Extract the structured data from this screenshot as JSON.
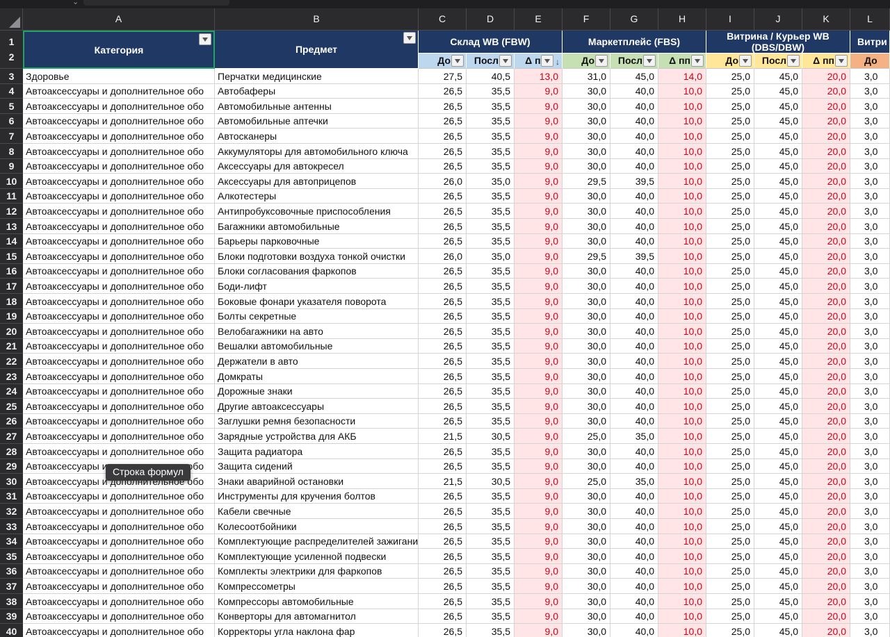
{
  "columns": [
    "A",
    "B",
    "C",
    "D",
    "E",
    "F",
    "G",
    "H",
    "I",
    "J",
    "K",
    "L"
  ],
  "row_numbers_header": [
    "1",
    "2"
  ],
  "headers": {
    "category": "Категория",
    "subject": "Предмет",
    "groups": [
      {
        "title": "Склад WB (FBW)",
        "color": "#bdd7ee"
      },
      {
        "title": "Маркетплейс (FBS)",
        "color": "#c6e0b4"
      },
      {
        "title": "Витрина / Курьер WB (DBS/DBW)",
        "color": "#ffe699"
      },
      {
        "title": "Витри",
        "color": "#f8cbad"
      }
    ],
    "subcols": [
      "До",
      "Посл",
      "Δ пп",
      "До",
      "Посл",
      "Δ пп",
      "До",
      "Посл",
      "Δ пп",
      "До"
    ]
  },
  "rows": [
    {
      "n": "3",
      "cat": "Здоровье",
      "subj": "Перчатки медицинские",
      "v": [
        "27,5",
        "40,5",
        "13,0",
        "31,0",
        "45,0",
        "14,0",
        "25,0",
        "45,0",
        "20,0",
        "3,0"
      ]
    },
    {
      "n": "4",
      "cat": "Автоаксессуары и дополнительное обо",
      "subj": "Автобаферы",
      "v": [
        "26,5",
        "35,5",
        "9,0",
        "30,0",
        "40,0",
        "10,0",
        "25,0",
        "45,0",
        "20,0",
        "3,0"
      ]
    },
    {
      "n": "5",
      "cat": "Автоаксессуары и дополнительное обо",
      "subj": "Автомобильные антенны",
      "v": [
        "26,5",
        "35,5",
        "9,0",
        "30,0",
        "40,0",
        "10,0",
        "25,0",
        "45,0",
        "20,0",
        "3,0"
      ]
    },
    {
      "n": "6",
      "cat": "Автоаксессуары и дополнительное обо",
      "subj": "Автомобильные аптечки",
      "v": [
        "26,5",
        "35,5",
        "9,0",
        "30,0",
        "40,0",
        "10,0",
        "25,0",
        "45,0",
        "20,0",
        "3,0"
      ]
    },
    {
      "n": "7",
      "cat": "Автоаксессуары и дополнительное обо",
      "subj": "Автосканеры",
      "v": [
        "26,5",
        "35,5",
        "9,0",
        "30,0",
        "40,0",
        "10,0",
        "25,0",
        "45,0",
        "20,0",
        "3,0"
      ]
    },
    {
      "n": "8",
      "cat": "Автоаксессуары и дополнительное обо",
      "subj": "Аккумуляторы для автомобильного ключа",
      "v": [
        "26,5",
        "35,5",
        "9,0",
        "30,0",
        "40,0",
        "10,0",
        "25,0",
        "45,0",
        "20,0",
        "3,0"
      ]
    },
    {
      "n": "9",
      "cat": "Автоаксессуары и дополнительное обо",
      "subj": "Аксессуары для автокресел",
      "v": [
        "26,5",
        "35,5",
        "9,0",
        "30,0",
        "40,0",
        "10,0",
        "25,0",
        "45,0",
        "20,0",
        "3,0"
      ]
    },
    {
      "n": "10",
      "cat": "Автоаксессуары и дополнительное обо",
      "subj": "Аксессуары для автоприцепов",
      "v": [
        "26,0",
        "35,0",
        "9,0",
        "29,5",
        "39,5",
        "10,0",
        "25,0",
        "45,0",
        "20,0",
        "3,0"
      ]
    },
    {
      "n": "11",
      "cat": "Автоаксессуары и дополнительное обо",
      "subj": "Алкотестеры",
      "v": [
        "26,5",
        "35,5",
        "9,0",
        "30,0",
        "40,0",
        "10,0",
        "25,0",
        "45,0",
        "20,0",
        "3,0"
      ]
    },
    {
      "n": "12",
      "cat": "Автоаксессуары и дополнительное обо",
      "subj": "Антипробуксовочные приспособления",
      "v": [
        "26,5",
        "35,5",
        "9,0",
        "30,0",
        "40,0",
        "10,0",
        "25,0",
        "45,0",
        "20,0",
        "3,0"
      ]
    },
    {
      "n": "13",
      "cat": "Автоаксессуары и дополнительное обо",
      "subj": "Багажники автомобильные",
      "v": [
        "26,5",
        "35,5",
        "9,0",
        "30,0",
        "40,0",
        "10,0",
        "25,0",
        "45,0",
        "20,0",
        "3,0"
      ]
    },
    {
      "n": "14",
      "cat": "Автоаксессуары и дополнительное обо",
      "subj": "Барьеры парковочные",
      "v": [
        "26,5",
        "35,5",
        "9,0",
        "30,0",
        "40,0",
        "10,0",
        "25,0",
        "45,0",
        "20,0",
        "3,0"
      ]
    },
    {
      "n": "15",
      "cat": "Автоаксессуары и дополнительное обо",
      "subj": "Блоки подготовки воздуха тонкой очистки",
      "v": [
        "26,0",
        "35,0",
        "9,0",
        "29,5",
        "39,5",
        "10,0",
        "25,0",
        "45,0",
        "20,0",
        "3,0"
      ]
    },
    {
      "n": "16",
      "cat": "Автоаксессуары и дополнительное обо",
      "subj": "Блоки согласования фаркопов",
      "v": [
        "26,5",
        "35,5",
        "9,0",
        "30,0",
        "40,0",
        "10,0",
        "25,0",
        "45,0",
        "20,0",
        "3,0"
      ]
    },
    {
      "n": "17",
      "cat": "Автоаксессуары и дополнительное обо",
      "subj": "Боди-лифт",
      "v": [
        "26,5",
        "35,5",
        "9,0",
        "30,0",
        "40,0",
        "10,0",
        "25,0",
        "45,0",
        "20,0",
        "3,0"
      ]
    },
    {
      "n": "18",
      "cat": "Автоаксессуары и дополнительное обо",
      "subj": "Боковые фонари указателя поворота",
      "v": [
        "26,5",
        "35,5",
        "9,0",
        "30,0",
        "40,0",
        "10,0",
        "25,0",
        "45,0",
        "20,0",
        "3,0"
      ]
    },
    {
      "n": "19",
      "cat": "Автоаксессуары и дополнительное обо",
      "subj": "Болты секретные",
      "v": [
        "26,5",
        "35,5",
        "9,0",
        "30,0",
        "40,0",
        "10,0",
        "25,0",
        "45,0",
        "20,0",
        "3,0"
      ]
    },
    {
      "n": "20",
      "cat": "Автоаксессуары и дополнительное обо",
      "subj": "Велобагажники на авто",
      "v": [
        "26,5",
        "35,5",
        "9,0",
        "30,0",
        "40,0",
        "10,0",
        "25,0",
        "45,0",
        "20,0",
        "3,0"
      ]
    },
    {
      "n": "21",
      "cat": "Автоаксессуары и дополнительное обо",
      "subj": "Вешалки автомобильные",
      "v": [
        "26,5",
        "35,5",
        "9,0",
        "30,0",
        "40,0",
        "10,0",
        "25,0",
        "45,0",
        "20,0",
        "3,0"
      ]
    },
    {
      "n": "22",
      "cat": "Автоаксессуары и дополнительное обо",
      "subj": "Держатели в авто",
      "v": [
        "26,5",
        "35,5",
        "9,0",
        "30,0",
        "40,0",
        "10,0",
        "25,0",
        "45,0",
        "20,0",
        "3,0"
      ]
    },
    {
      "n": "23",
      "cat": "Автоаксессуары и дополнительное обо",
      "subj": "Домкраты",
      "v": [
        "26,5",
        "35,5",
        "9,0",
        "30,0",
        "40,0",
        "10,0",
        "25,0",
        "45,0",
        "20,0",
        "3,0"
      ]
    },
    {
      "n": "24",
      "cat": "Автоаксессуары и дополнительное обо",
      "subj": "Дорожные знаки",
      "v": [
        "26,5",
        "35,5",
        "9,0",
        "30,0",
        "40,0",
        "10,0",
        "25,0",
        "45,0",
        "20,0",
        "3,0"
      ]
    },
    {
      "n": "25",
      "cat": "Автоаксессуары и дополнительное обо",
      "subj": "Другие автоаксессуары",
      "v": [
        "26,5",
        "35,5",
        "9,0",
        "30,0",
        "40,0",
        "10,0",
        "25,0",
        "45,0",
        "20,0",
        "3,0"
      ]
    },
    {
      "n": "26",
      "cat": "Автоаксессуары и дополнительное обо",
      "subj": "Заглушки ремня безопасности",
      "v": [
        "26,5",
        "35,5",
        "9,0",
        "30,0",
        "40,0",
        "10,0",
        "25,0",
        "45,0",
        "20,0",
        "3,0"
      ]
    },
    {
      "n": "27",
      "cat": "Автоаксессуары и дополнительное обо",
      "subj": "Зарядные устройства для АКБ",
      "v": [
        "21,5",
        "30,5",
        "9,0",
        "25,0",
        "35,0",
        "10,0",
        "25,0",
        "45,0",
        "20,0",
        "3,0"
      ]
    },
    {
      "n": "28",
      "cat": "Автоаксессуары и дополнительное обо",
      "subj": "Защита радиатора",
      "v": [
        "26,5",
        "35,5",
        "9,0",
        "30,0",
        "40,0",
        "10,0",
        "25,0",
        "45,0",
        "20,0",
        "3,0"
      ]
    },
    {
      "n": "29",
      "cat": "Автоаксессуары и дополнительное обо",
      "subj": "Защита сидений",
      "v": [
        "26,5",
        "35,5",
        "9,0",
        "30,0",
        "40,0",
        "10,0",
        "25,0",
        "45,0",
        "20,0",
        "3,0"
      ]
    },
    {
      "n": "30",
      "cat": "Автоаксессуары и дополнительное обо",
      "subj": "Знаки аварийной остановки",
      "v": [
        "21,5",
        "30,5",
        "9,0",
        "25,0",
        "35,0",
        "10,0",
        "25,0",
        "45,0",
        "20,0",
        "3,0"
      ]
    },
    {
      "n": "31",
      "cat": "Автоаксессуары и дополнительное обо",
      "subj": "Инструменты для кручения болтов",
      "v": [
        "26,5",
        "35,5",
        "9,0",
        "30,0",
        "40,0",
        "10,0",
        "25,0",
        "45,0",
        "20,0",
        "3,0"
      ]
    },
    {
      "n": "32",
      "cat": "Автоаксессуары и дополнительное обо",
      "subj": "Кабели свечные",
      "v": [
        "26,5",
        "35,5",
        "9,0",
        "30,0",
        "40,0",
        "10,0",
        "25,0",
        "45,0",
        "20,0",
        "3,0"
      ]
    },
    {
      "n": "33",
      "cat": "Автоаксессуары и дополнительное обо",
      "subj": "Колесоотбойники",
      "v": [
        "26,5",
        "35,5",
        "9,0",
        "30,0",
        "40,0",
        "10,0",
        "25,0",
        "45,0",
        "20,0",
        "3,0"
      ]
    },
    {
      "n": "34",
      "cat": "Автоаксессуары и дополнительное обо",
      "subj": "Комплектующие распределителей зажигания",
      "v": [
        "26,5",
        "35,5",
        "9,0",
        "30,0",
        "40,0",
        "10,0",
        "25,0",
        "45,0",
        "20,0",
        "3,0"
      ]
    },
    {
      "n": "35",
      "cat": "Автоаксессуары и дополнительное обо",
      "subj": "Комплектующие усиленной подвески",
      "v": [
        "26,5",
        "35,5",
        "9,0",
        "30,0",
        "40,0",
        "10,0",
        "25,0",
        "45,0",
        "20,0",
        "3,0"
      ]
    },
    {
      "n": "36",
      "cat": "Автоаксессуары и дополнительное обо",
      "subj": "Комплекты электрики для фаркопов",
      "v": [
        "26,5",
        "35,5",
        "9,0",
        "30,0",
        "40,0",
        "10,0",
        "25,0",
        "45,0",
        "20,0",
        "3,0"
      ]
    },
    {
      "n": "37",
      "cat": "Автоаксессуары и дополнительное обо",
      "subj": "Компрессометры",
      "v": [
        "26,5",
        "35,5",
        "9,0",
        "30,0",
        "40,0",
        "10,0",
        "25,0",
        "45,0",
        "20,0",
        "3,0"
      ]
    },
    {
      "n": "38",
      "cat": "Автоаксессуары и дополнительное обо",
      "subj": "Компрессоры автомобильные",
      "v": [
        "26,5",
        "35,5",
        "9,0",
        "30,0",
        "40,0",
        "10,0",
        "25,0",
        "45,0",
        "20,0",
        "3,0"
      ]
    },
    {
      "n": "39",
      "cat": "Автоаксессуары и дополнительное обо",
      "subj": "Конверторы для автомагнитол",
      "v": [
        "26,5",
        "35,5",
        "9,0",
        "30,0",
        "40,0",
        "10,0",
        "25,0",
        "45,0",
        "20,0",
        "3,0"
      ]
    },
    {
      "n": "40",
      "cat": "Автоаксессуары и дополнительное обо",
      "subj": "Корректоры угла наклона фар",
      "v": [
        "26,5",
        "35,5",
        "9,0",
        "30,0",
        "40,0",
        "10,0",
        "25,0",
        "45,0",
        "20,0",
        "3,0"
      ]
    }
  ],
  "tooltip": "Строка формул"
}
